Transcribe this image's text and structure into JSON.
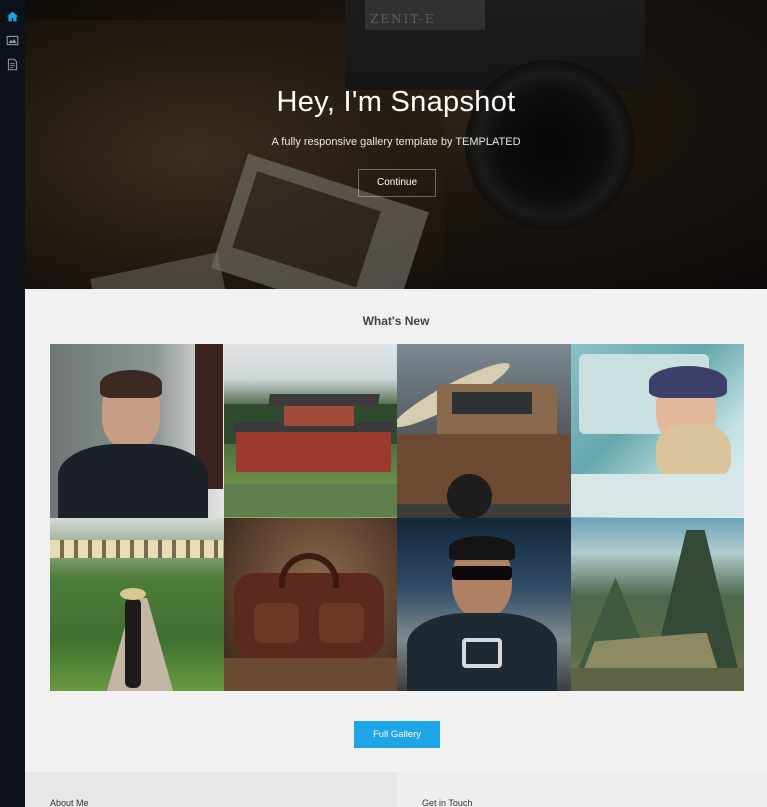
{
  "sidebar": {
    "items": [
      {
        "icon": "home-icon",
        "color": "#1ea5e8"
      },
      {
        "icon": "gallery-icon",
        "color": "#8a97a4"
      },
      {
        "icon": "document-icon",
        "color": "#8a97a4"
      }
    ]
  },
  "hero": {
    "brand_mark": "ZENIT-E",
    "title": "Hey, I'm Snapshot",
    "subtitle": "A fully responsive gallery template by TEMPLATED",
    "cta_label": "Continue"
  },
  "whats_new": {
    "heading": "What's New",
    "tiles": [
      {
        "subject": "man in suit portrait"
      },
      {
        "subject": "japanese temple by pond"
      },
      {
        "subject": "rusty vintage pickup truck"
      },
      {
        "subject": "woman leaning out of car window"
      },
      {
        "subject": "woman walking lantern path"
      },
      {
        "subject": "leather duffel bag"
      },
      {
        "subject": "man with sunglasses smoking"
      },
      {
        "subject": "mountain ruins landscape"
      }
    ],
    "button_label": "Full Gallery",
    "accent": "#1ea5e8"
  },
  "footer": {
    "about_heading": "About Me",
    "contact_heading": "Get in Touch"
  }
}
